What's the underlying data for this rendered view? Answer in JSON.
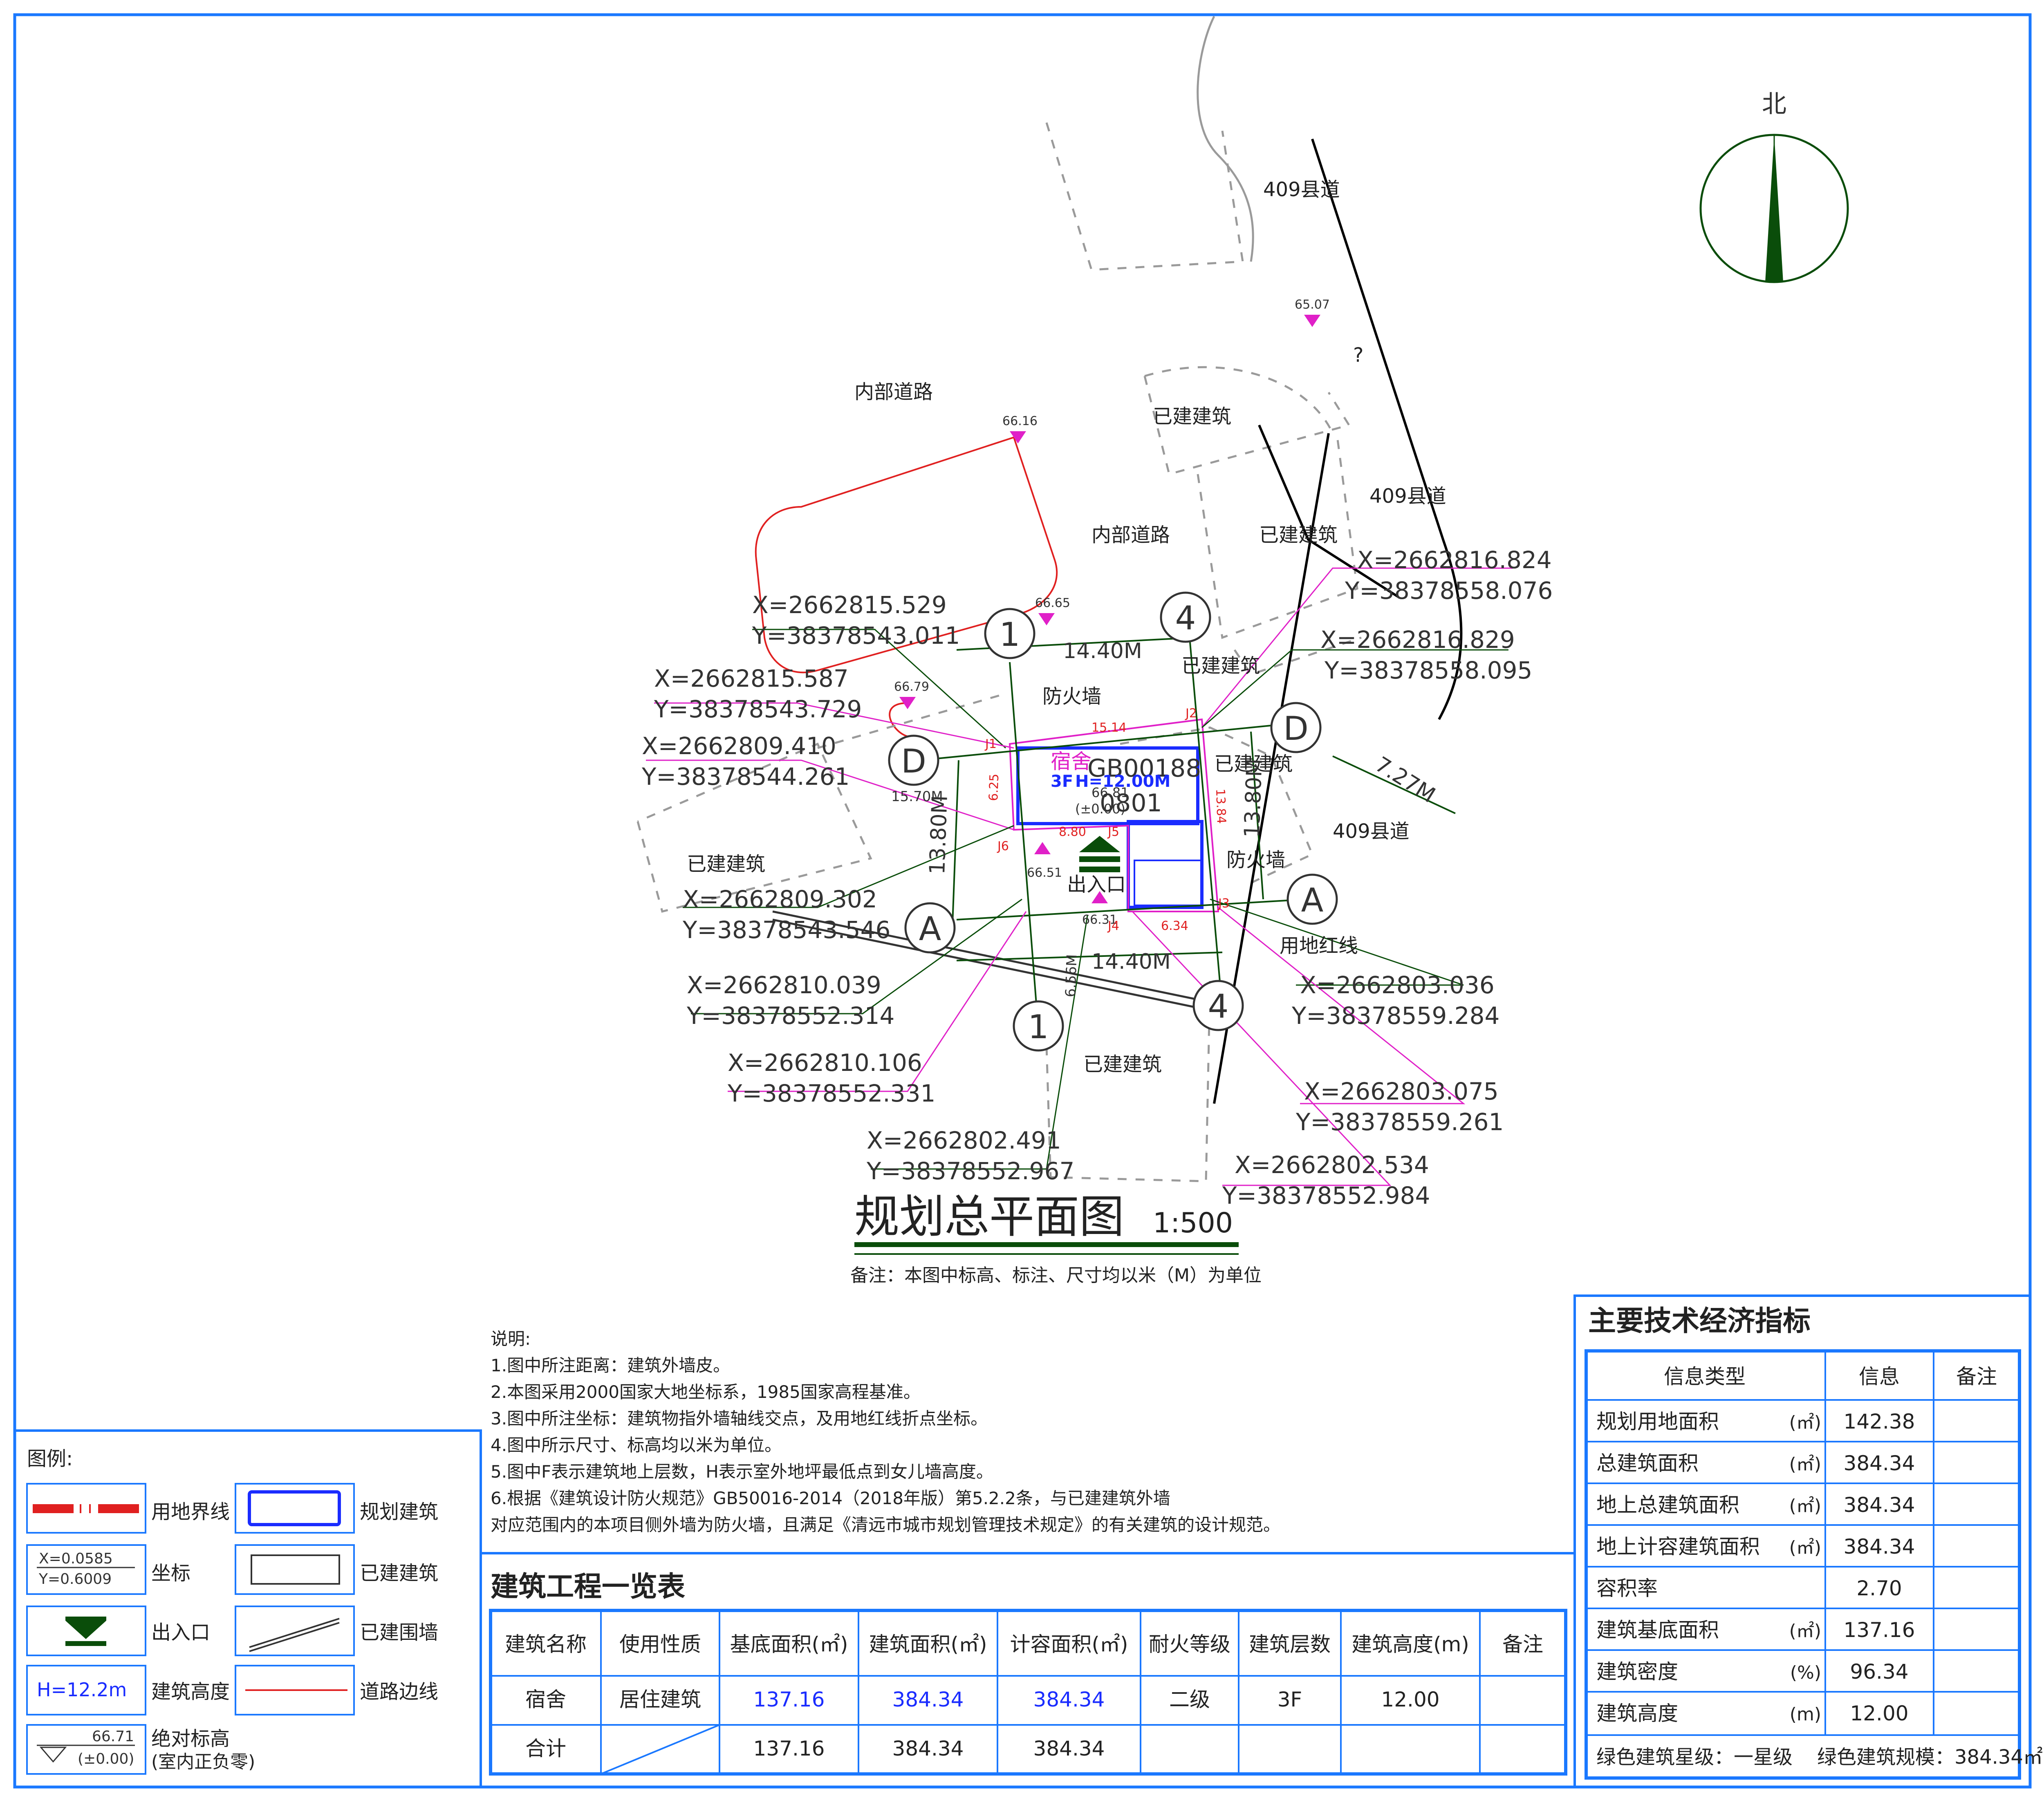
{
  "title": "规划总平面图",
  "scale": "1:500",
  "remark": "备注：本图中标高、标注、尺寸均以米（M）为单位",
  "north_label": "北",
  "colors": {
    "frame": "#1a78ff",
    "green": "#0a4d0a",
    "magenta": "#e020c8",
    "red": "#e02020",
    "blue": "#1a2cff",
    "gray": "#9a9a9a"
  },
  "map_labels": {
    "road_409_a": "409县道",
    "road_409_b": "409县道",
    "road_409_c": "409县道",
    "internal_road_a": "内部道路",
    "internal_road_b": "内部道路",
    "existing_a": "已建建筑",
    "existing_b": "已建建筑",
    "existing_c": "已建建筑",
    "existing_d": "已建建筑",
    "existing_e": "已建建筑",
    "existing_f": "已建建筑",
    "question_mark": "?",
    "fire_wall_a": "防火墙",
    "fire_wall_b": "防火墙",
    "entrance": "出入口",
    "land_line": "用地红线",
    "building_name": "宿舍",
    "building_floors": "3F",
    "building_height": "H=12.00M",
    "building_code_a": "GB00188",
    "building_code_b": "0801",
    "building_level": "66.81",
    "building_level_zero": "(±0.00)"
  },
  "elevations": [
    "66.16",
    "66.65",
    "66.79",
    "65.07",
    "66.51",
    "66.31"
  ],
  "axis_labels": {
    "a1": "1",
    "a2": "4",
    "a3": "D",
    "a4": "D",
    "a5": "A",
    "a6": "A",
    "a7": "1",
    "a8": "4"
  },
  "dimensions": {
    "d1": "14.40M",
    "d2": "14.40M",
    "d3": "15.70M",
    "d4": "13.80M",
    "d5": "13.80M",
    "d6": "6.56M",
    "d7": "7.27M",
    "r1": "15.14",
    "r2": "6.25",
    "r3": "8.80",
    "r4": "13.84",
    "r5": "6.34",
    "j1": "J1",
    "j2": "J2",
    "j3": "J3",
    "j4": "J4",
    "j5": "J5",
    "j6": "J6"
  },
  "coords": [
    {
      "x": "X=2662815.529",
      "y": "Y=38378543.011"
    },
    {
      "x": "X=2662815.587",
      "y": "Y=38378543.729"
    },
    {
      "x": "X=2662809.410",
      "y": "Y=38378544.261"
    },
    {
      "x": "X=2662809.302",
      "y": "Y=38378543.546"
    },
    {
      "x": "X=2662810.039",
      "y": "Y=38378552.314"
    },
    {
      "x": "X=2662810.106",
      "y": "Y=38378552.331"
    },
    {
      "x": "X=2662802.491",
      "y": "Y=38378552.967"
    },
    {
      "x": "X=2662816.824",
      "y": "Y=38378558.076"
    },
    {
      "x": "X=2662816.829",
      "y": "Y=38378558.095"
    },
    {
      "x": "X=2662803.036",
      "y": "Y=38378559.284"
    },
    {
      "x": "X=2662803.075",
      "y": "Y=38378559.261"
    },
    {
      "x": "X=2662802.534",
      "y": "Y=38378552.984"
    }
  ],
  "notes": {
    "heading": "说明:",
    "lines": [
      "1.图中所注距离：建筑外墙皮。",
      "2.本图采用2000国家大地坐标系，1985国家高程基准。",
      "3.图中所注坐标：建筑物指外墙轴线交点，及用地红线折点坐标。",
      "4.图中所示尺寸、标高均以米为单位。",
      "5.图中F表示建筑地上层数，H表示室外地坪最低点到女儿墙高度。",
      "6.根据《建筑设计防火规范》GB50016-2014（2018年版）第5.2.2条，与已建建筑外墙",
      "对应范围内的本项目侧外墙为防火墙，且满足《清远市城市规划管理技术规定》的有关建筑的设计规范。"
    ]
  },
  "legend": {
    "title": "图例:",
    "items": {
      "land_boundary": "用地界线",
      "planned_building": "规划建筑",
      "coordinate": "坐标",
      "existing_building": "已建建筑",
      "entrance": "出入口",
      "existing_wall": "已建围墙",
      "building_height": "建筑高度",
      "road_edge": "道路边线",
      "absolute_level": "绝对标高",
      "absolute_level_sub": "(室内正负零)"
    },
    "sample_coord_x": "X=0.0585",
    "sample_coord_y": "Y=0.6009",
    "sample_height": "H=12.2m",
    "sample_level": "66.71",
    "sample_level_zero": "(±0.00)"
  },
  "project_table": {
    "title": "建筑工程一览表",
    "headers": [
      "建筑名称",
      "使用性质",
      "基底面积(㎡)",
      "建筑面积(㎡)",
      "计容面积(㎡)",
      "耐火等级",
      "建筑层数",
      "建筑高度(m)",
      "备注"
    ],
    "rows": [
      [
        "宿舍",
        "居住建筑",
        "137.16",
        "384.34",
        "384.34",
        "二级",
        "3F",
        "12.00",
        ""
      ],
      [
        "合计",
        "",
        "137.16",
        "384.34",
        "384.34",
        "",
        "",
        "",
        ""
      ]
    ]
  },
  "indicators": {
    "title": "主要技术经济指标",
    "headers": [
      "信息类型",
      "信息",
      "备注"
    ],
    "rows": [
      {
        "name": "规划用地面积",
        "unit": "(㎡)",
        "value": "142.38"
      },
      {
        "name": "总建筑面积",
        "unit": "(㎡)",
        "value": "384.34"
      },
      {
        "name": "地上总建筑面积",
        "unit": "(㎡)",
        "value": "384.34"
      },
      {
        "name": "地上计容建筑面积",
        "unit": "(㎡)",
        "value": "384.34"
      },
      {
        "name": "容积率",
        "unit": "",
        "value": "2.70"
      },
      {
        "name": "建筑基底面积",
        "unit": "(㎡)",
        "value": "137.16"
      },
      {
        "name": "建筑密度",
        "unit": "(%)",
        "value": "96.34"
      },
      {
        "name": "建筑高度",
        "unit": "(m)",
        "value": "12.00"
      }
    ],
    "footer_left": "绿色建筑星级：一星级",
    "footer_right": "绿色建筑规模：384.34㎡"
  }
}
